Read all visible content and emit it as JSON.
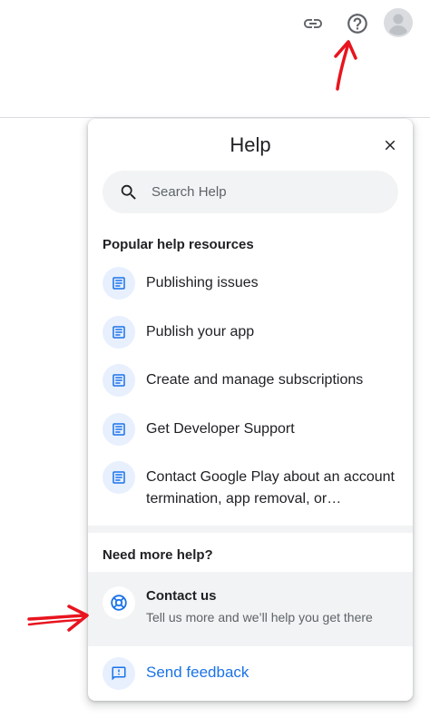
{
  "topbar": {
    "icons": [
      "link-icon",
      "help-circle-icon",
      "account-avatar-icon"
    ]
  },
  "panel": {
    "title": "Help",
    "search": {
      "placeholder": "Search Help",
      "value": ""
    },
    "popular_title": "Popular help resources",
    "resources": [
      {
        "label": "Publishing issues",
        "icon": "article-icon"
      },
      {
        "label": "Publish your app",
        "icon": "article-icon"
      },
      {
        "label": "Create and manage subscriptions",
        "icon": "article-icon"
      },
      {
        "label": "Get Developer Support",
        "icon": "article-icon"
      },
      {
        "label": "Contact Google Play about an account termination, app removal, or…",
        "icon": "article-icon"
      }
    ],
    "need_more_title": "Need more help?",
    "contact": {
      "title": "Contact us",
      "subtitle": "Tell us more and we’ll help you get there",
      "icon": "support-icon"
    },
    "feedback": {
      "label": "Send feedback",
      "icon": "feedback-icon"
    }
  },
  "colors": {
    "accent": "#1a73e8",
    "annotation": "#e8141e",
    "icon_bg": "#e8f0fe",
    "highlight_bg": "#f1f3f4"
  }
}
